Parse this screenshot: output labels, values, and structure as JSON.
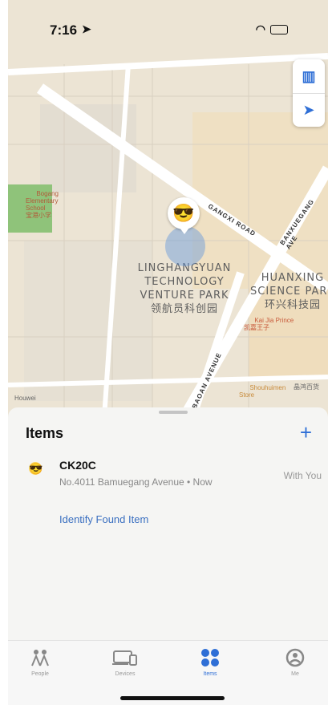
{
  "status_bar": {
    "time": "7:16",
    "location_icon": "location-arrow-icon",
    "wifi_icon": "wifi-icon",
    "battery_icon": "battery-icon"
  },
  "map": {
    "controls": {
      "map_mode_icon": "map-icon",
      "locate_icon": "location-arrow-icon"
    },
    "area_labels": {
      "linghang": "LINGHANGYUAN\nTECHNOLOGY\nVENTURE PARK\n领航员科创园",
      "huanxing": "HUANXING\nSCIENCE PARK\n环兴科技园"
    },
    "road_labels": {
      "gangxi": "GANGXI ROAD",
      "baoan": "BAOAN AVENUE",
      "banxuegang": "BANXUEGANG AVE"
    },
    "pois": {
      "school": "Bogang\nElementary\nSchool\n宝港小学",
      "kaijia": "Kai Jia Prince\n凯嘉王子",
      "shouhuimen": "Shouhuimen\nStore",
      "houwei": "Houwei",
      "store_cn": "晶鸿百货"
    },
    "pin_emoji": "😎"
  },
  "sheet": {
    "title": "Items",
    "add_label": "+",
    "items": [
      {
        "emoji": "😎",
        "name": "CK20C",
        "location": "No.4011 Bamuegang Avenue • Now",
        "status": "With You"
      }
    ],
    "identify_link": "Identify Found Item"
  },
  "tabbar": {
    "tabs": [
      {
        "label": "People",
        "icon": "people-icon",
        "active": false
      },
      {
        "label": "Devices",
        "icon": "devices-icon",
        "active": false
      },
      {
        "label": "Items",
        "icon": "items-icon",
        "active": true
      },
      {
        "label": "Me",
        "icon": "me-icon",
        "active": false
      }
    ]
  },
  "colors": {
    "accent": "#2f6fd6",
    "map_bg": "#efe9dd",
    "park_green": "#8fc37a",
    "road_white": "#ffffff"
  }
}
